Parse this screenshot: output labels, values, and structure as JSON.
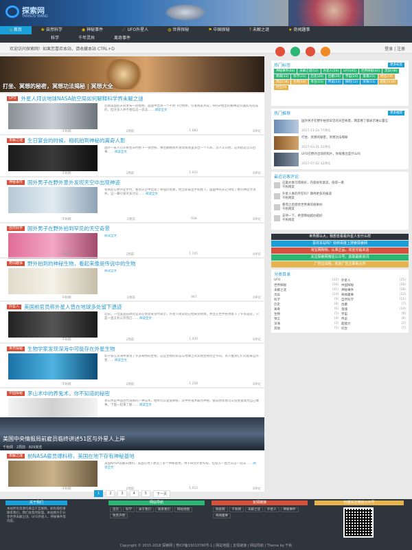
{
  "header": {
    "logo_text": "探索网",
    "logo_sub": "TANSUO WANG"
  },
  "nav": {
    "row1": [
      {
        "label": "首页",
        "icon": "home-icon",
        "glyph": "⌂",
        "active": true
      },
      {
        "label": "自然科学",
        "icon": "leaf-icon",
        "glyph": "❀"
      },
      {
        "label": "神秘事件",
        "icon": "eye-icon",
        "glyph": "◉"
      },
      {
        "label": "UFO外星人",
        "icon": "alien-icon",
        "glyph": "☄"
      },
      {
        "label": "世界探秘",
        "icon": "globe-icon",
        "glyph": "◍"
      },
      {
        "label": "中国探秘",
        "icon": "flag-icon",
        "glyph": "⚑"
      },
      {
        "label": "未解之谜",
        "icon": "question-icon",
        "glyph": "?"
      },
      {
        "label": "奇闻趣事",
        "icon": "star-icon",
        "glyph": "★"
      }
    ],
    "row2": [
      {
        "label": "科学"
      },
      {
        "label": "千年灵异"
      },
      {
        "label": "离奇事件"
      }
    ]
  },
  "notice": {
    "text": "欢迎访问探索网！如果您喜欢本站，请收藏本站 CTRL+D",
    "right": "登录 | 注册"
  },
  "slider": {
    "caption": "打坐、冥想的秘密，冥想功法揭秘 | 冥想大全"
  },
  "posts": [
    {
      "tag": "UFO",
      "title": "外星人拜访地球NASA航空局如何解释科学界未解之谜",
      "excerpt": "近期美国航天局发布一段视频，画面中出现一个不明飞行物体，引发网友热议，NASA给出的解释是仪器反光造成的，但许多人并不相信这一说法……",
      "more": "阅读全文",
      "author": "千秋网",
      "time": "2周前",
      "views": "1,983",
      "comments": "0评论"
    },
    {
      "tag": "未解之谜",
      "title": "生日宴会的时候，相机拍到神秘的离奇人影",
      "excerpt": "国外一家人在庆祝生日时拍下一张合照，事后翻看照片发现角落里多出一个人影，没人认识他，这到底是怎么回事……",
      "more": "阅读全文",
      "author": "千秋网",
      "time": "2周前",
      "views": "1,032",
      "comments": "0评论"
    },
    {
      "tag": "神秘事件",
      "title": "国外男子在野外意外发现天空中出现神迹",
      "excerpt": "有网友在野外徒步时，看到天空中出现了奇怪的景象，他立即拿出手机拍下，画面中的光芒持续了数分钟后才消失，这一幕引发许多讨论……",
      "more": "阅读全文",
      "author": "千秋网",
      "time": "2周前",
      "views": "938",
      "comments": "0评论"
    },
    {
      "tag": "自然科学",
      "title": "国外男子在野外拍到罕见的天空奇景",
      "excerpt": "",
      "more": "阅读全文",
      "author": "千秋网",
      "time": "2周前",
      "views": "1,105",
      "comments": "0评论"
    },
    {
      "tag": "奇闻趣事",
      "title": "野外拍到的神秘生物，看起来像是传说中的生物",
      "excerpt": "",
      "more": "阅读全文",
      "author": "千秋网",
      "time": "2周前",
      "views": "987",
      "comments": "0评论"
    },
    {
      "tag": "外星人",
      "title": "美国前官员称外星人曾在地球多处留下遗迹",
      "excerpt": "近日，一位美国前政府官员在接受采访时表示，外星人很早就已经来到地球，并且在世界各地留下了许多遗迹，只是一直没有公开而已……",
      "more": "阅读全文",
      "author": "千秋网",
      "time": "2周前",
      "views": "1,420",
      "comments": "0评论"
    },
    {
      "tag": "世界探秘",
      "title": "生物学家发现深海中可能存在外星生物",
      "excerpt": "科学家在深海中发现了许多奇特的生物，这些生物的形态与地球上的其他生物完全不同，有人推测它们可能来自外星……",
      "more": "阅读全文",
      "author": "千秋网",
      "time": "2周前",
      "views": "1,258",
      "comments": "0评论"
    },
    {
      "tag": "中国探秘",
      "title": "茅山术中的养鬼术，你不知道的秘密",
      "excerpt": "茅山术是中国古代道教的一种法术，相传可以驱鬼降妖，其中养鬼术最为神秘，据说修炼者可以役使鬼魂为自己做事，下面一起来了解……",
      "more": "阅读全文",
      "author": "千秋网",
      "time": "2周前",
      "views": "1,645",
      "comments": "0评论"
    },
    {
      "tag": "未解之谜",
      "title": "前NASA雇员爆料称，美国在地下存有神秘基地",
      "excerpt": "美国NASA前雇员爆料，美国在地下建造了多个神秘基地，用于研究外星科技，但官方一直否认这一说法……",
      "more": "阅读全文",
      "author": "千秋网",
      "time": "2周前",
      "views": "1,012",
      "comments": "0评论"
    }
  ],
  "feature": {
    "title": "美国中央情报局前雇员临终讲述51区与外星人上岸",
    "meta": "千秋网  ·  2周前  ·  829浏览"
  },
  "pager": {
    "pages": [
      "1",
      "2",
      "3",
      "4",
      "5"
    ],
    "next": "下一页"
  },
  "sidebar": {
    "hot_tags_title": "热门标签",
    "hot_tags_badge": "更多标签",
    "tags": [
      {
        "label": "神秘事件(64)",
        "color": "#2bb673"
      },
      {
        "label": "未解之谜(52)",
        "color": "#2bb673"
      },
      {
        "label": "外星人(50)",
        "color": "#2bb673"
      },
      {
        "label": "UFO(45)",
        "color": "#2bb673"
      },
      {
        "label": "世界探秘(42)",
        "color": "#2bb673"
      },
      {
        "label": "灵异(38)",
        "color": "#2bb673"
      },
      {
        "label": "奇闻(33)",
        "color": "#2bb673"
      },
      {
        "label": "科学(31)",
        "color": "#2bb673"
      },
      {
        "label": "历史(28)",
        "color": "#2bb673"
      },
      {
        "label": "古墓(26)",
        "color": "#2bb673"
      },
      {
        "label": "宇宙(24)",
        "color": "#2bb673"
      },
      {
        "label": "鬼魂(21)",
        "color": "#2bb673"
      },
      {
        "label": "神话(19)",
        "color": "#e6b34f"
      },
      {
        "label": "预言(18)",
        "color": "#e6b34f"
      },
      {
        "label": "生物(16)",
        "color": "#e6b34f"
      },
      {
        "label": "考古(15)",
        "color": "#2bb673"
      },
      {
        "label": "传说(13)",
        "color": "#1a9fd9"
      },
      {
        "label": "探险(12)",
        "color": "#1a9fd9"
      },
      {
        "label": "深海(11)",
        "color": "#1a9fd9"
      },
      {
        "label": "超能力(10)",
        "color": "#e6b34f"
      },
      {
        "label": "时空(9)",
        "color": "#e6b34f"
      }
    ],
    "hot_title": "热门推荐",
    "hot_badge": "更多推荐",
    "hot": [
      {
        "title": "国外男子在野外拍到罕见的天空奇景，网友看了都表示难以置信",
        "date": "2017-11-24  77评论"
      },
      {
        "title": "打坐、冥想的秘密，冥想功法揭秘",
        "date": "2017-03-31  32评论"
      },
      {
        "title": "UFO在野外出现的照片，你能看出是什么吗",
        "date": "2017-07-02  32评论"
      }
    ],
    "comments_title": "最近访客评论",
    "comments": [
      {
        "text": "这篇文章写得很好，内容很有意思，值得一看",
        "who": "千秋网友"
      },
      {
        "text": "外星人真的存在吗？期待更多的报道",
        "who": "千秋网友"
      },
      {
        "text": "看完之后感觉世界真的很奇妙",
        "who": "千秋网友"
      },
      {
        "text": "支持一下，希望网站越办越好",
        "who": "千秋网友"
      }
    ],
    "ads": [
      {
        "text": "世界那么大，我想去看看外星人长什么样",
        "color": "#2f353d"
      },
      {
        "text": "喜欢本站吗？快到百度上搜索探索网",
        "color": "#1a9fd9"
      },
      {
        "text": "淘宝网购物，认准正品，欢迎光临本店",
        "color": "#d6513b"
      },
      {
        "text": "关注探索网微信公众号，获取最新资讯",
        "color": "#2bb673"
      },
      {
        "text": "广告位出租，欢迎广告主联系合作",
        "color": "#e6b34f"
      }
    ],
    "cats_title": "分类目录",
    "cats": [
      {
        "name": "UFO",
        "n": "(22)"
      },
      {
        "name": "外星人",
        "n": "(25)"
      },
      {
        "name": "世界探秘",
        "n": "(18)"
      },
      {
        "name": "中国探秘",
        "n": "(16)"
      },
      {
        "name": "未解之谜",
        "n": "(31)"
      },
      {
        "name": "神秘事件",
        "n": "(28)"
      },
      {
        "name": "灵异",
        "n": "(14)"
      },
      {
        "name": "奇闻趣事",
        "n": "(12)"
      },
      {
        "name": "科学",
        "n": "(9)"
      },
      {
        "name": "自然科学",
        "n": "(11)"
      },
      {
        "name": "历史",
        "n": "(8)"
      },
      {
        "name": "古墓",
        "n": "(7)"
      },
      {
        "name": "离奇",
        "n": "(6)"
      },
      {
        "name": "鬼魂",
        "n": "(10)"
      },
      {
        "name": "生物",
        "n": "(5)"
      },
      {
        "name": "宇宙",
        "n": "(9)"
      },
      {
        "name": "预言",
        "n": "(4)"
      },
      {
        "name": "传说",
        "n": "(6)"
      },
      {
        "name": "深海",
        "n": "(3)"
      },
      {
        "name": "超能力",
        "n": "(2)"
      },
      {
        "name": "其他",
        "n": "(5)"
      },
      {
        "name": "综合",
        "n": "(7)"
      }
    ]
  },
  "footer": {
    "about_title": "关于我们",
    "about_text": "本站所有资源均来自于互联网，如有侵权请联系我们，我们会及时处理。本站致力于分享世界未解之谜、UFO外星人、神秘事件等内容。",
    "links_title": "网站导航",
    "links": [
      "首页",
      "科学",
      "关于我们",
      "联系我们",
      "网站地图",
      "免责声明"
    ],
    "friends_title": "友情链接",
    "friends": [
      "探索网",
      "千秋网",
      "未解之谜",
      "外星人",
      "神秘事件",
      "奇闻趣事"
    ],
    "qr_title": "扫描关注微信公众号",
    "copyright": "Copyright © 2015-2018 探索网 | 粤ICP备15013790号-1 | 网站地图 | 友情链接 | 网站导航 | Theme by 千秋"
  }
}
